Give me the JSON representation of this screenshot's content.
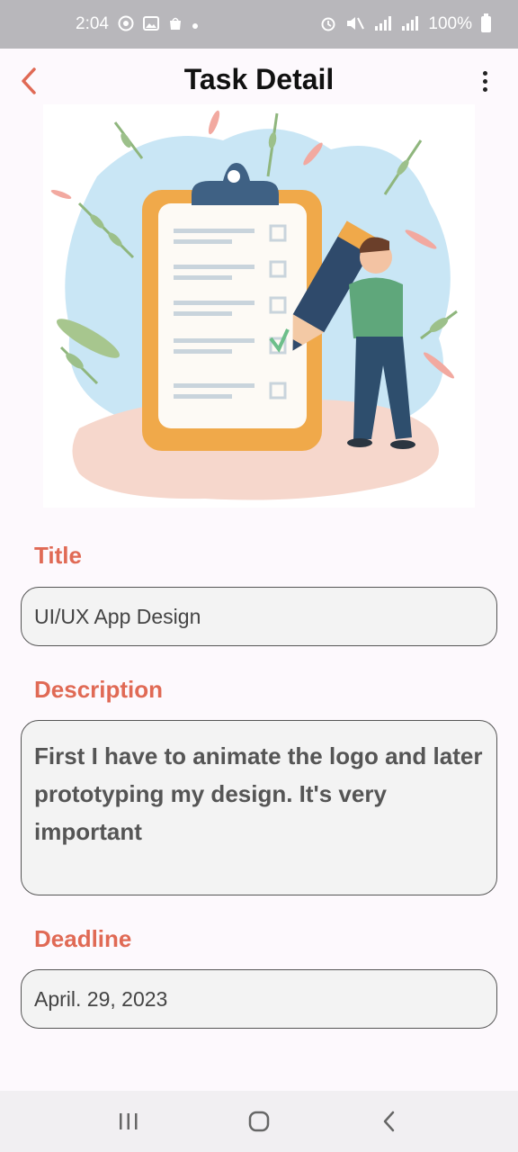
{
  "status_bar": {
    "time": "2:04",
    "battery": "100%",
    "icons": [
      "whatsapp-icon",
      "gallery-icon",
      "store-icon",
      "dot-icon",
      "alarm-icon",
      "mute-icon",
      "signal-icon",
      "signal-icon",
      "battery-icon"
    ]
  },
  "app_bar": {
    "title": "Task Detail",
    "back_icon": "chevron-left-icon",
    "menu_icon": "more-vert-icon",
    "accent_color": "#e06a55"
  },
  "form": {
    "title_label": "Title",
    "title_value": "UI/UX App Design",
    "description_label": "Description",
    "description_value": "First I have to animate the logo and later prototyping my design. It's very important",
    "deadline_label": "Deadline",
    "deadline_value": "April. 29, 2023"
  },
  "nav_bar": {
    "icons": [
      "recents-icon",
      "home-icon",
      "back-icon"
    ]
  }
}
